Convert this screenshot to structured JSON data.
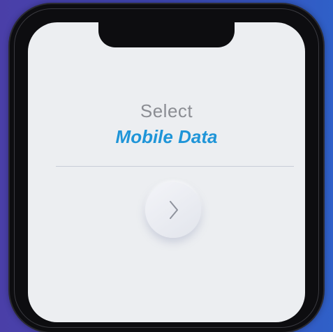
{
  "screen": {
    "heading": "Select",
    "subheading": "Mobile Data"
  },
  "icons": {
    "next": "chevron-right-icon"
  },
  "colors": {
    "background_gradient_start": "#4a3fa8",
    "background_gradient_end": "#2f60c8",
    "heading": "#8b8d93",
    "accent": "#1f95d8",
    "screen": "#eceef1"
  }
}
